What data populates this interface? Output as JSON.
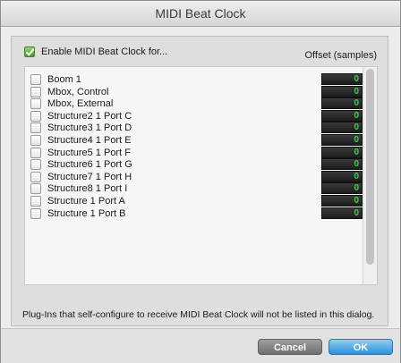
{
  "window": {
    "title": "MIDI Beat Clock"
  },
  "header": {
    "enable_label": "Enable MIDI Beat Clock for...",
    "enable_checked": true,
    "offset_label": "Offset (samples)"
  },
  "rows": [
    {
      "label": "Boom 1",
      "checked": false,
      "offset": "0"
    },
    {
      "label": "Mbox, Control",
      "checked": false,
      "offset": "0"
    },
    {
      "label": "Mbox, External",
      "checked": false,
      "offset": "0"
    },
    {
      "label": "Structure2 1 Port C",
      "checked": false,
      "offset": "0"
    },
    {
      "label": "Structure3 1 Port D",
      "checked": false,
      "offset": "0"
    },
    {
      "label": "Structure4 1 Port E",
      "checked": false,
      "offset": "0"
    },
    {
      "label": "Structure5 1 Port F",
      "checked": false,
      "offset": "0"
    },
    {
      "label": "Structure6 1 Port G",
      "checked": false,
      "offset": "0"
    },
    {
      "label": "Structure7 1 Port H",
      "checked": false,
      "offset": "0"
    },
    {
      "label": "Structure8 1 Port I",
      "checked": false,
      "offset": "0"
    },
    {
      "label": "Structure 1 Port A",
      "checked": false,
      "offset": "0"
    },
    {
      "label": "Structure 1 Port B",
      "checked": false,
      "offset": "0"
    }
  ],
  "note": "Plug-Ins that self-configure to receive MIDI Beat Clock will not be listed in this dialog.",
  "footer": {
    "cancel_label": "Cancel",
    "ok_label": "OK"
  },
  "colors": {
    "accent": "#3a95d9",
    "offset_text": "#39d24a",
    "checkbox_checked": "#5fb43a"
  }
}
